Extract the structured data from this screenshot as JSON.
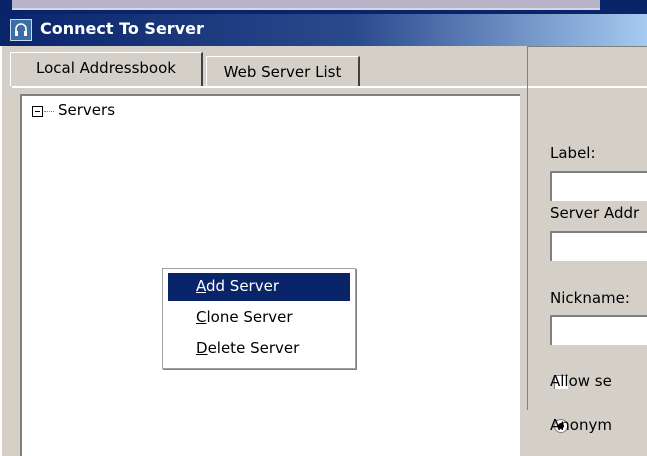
{
  "window": {
    "title": "Connect To Server"
  },
  "tabs": [
    "Local Addressbook",
    "Web Server List"
  ],
  "tree": {
    "root_label": "Servers"
  },
  "context_menu": [
    {
      "prefix": "",
      "mnemonic": "A",
      "rest": "dd Server",
      "selected": true
    },
    {
      "prefix": "",
      "mnemonic": "C",
      "rest": "lone Server",
      "selected": false
    },
    {
      "prefix": "",
      "mnemonic": "D",
      "rest": "elete Server",
      "selected": false
    }
  ],
  "form": {
    "label_label": "Label:",
    "label_value": "",
    "server_address_label": "Server Addr",
    "server_address_value": "",
    "nickname_label": "Nickname:",
    "nickname_value": "",
    "allow_checkbox_label": "Allow se",
    "allow_checked": false,
    "anonymous_radio_label": "Anonym",
    "anonymous_selected": true
  },
  "colors": {
    "title_gradient_start": "#0a246a",
    "menu_highlight": "#0a246a",
    "face": "#d4d0c8"
  }
}
